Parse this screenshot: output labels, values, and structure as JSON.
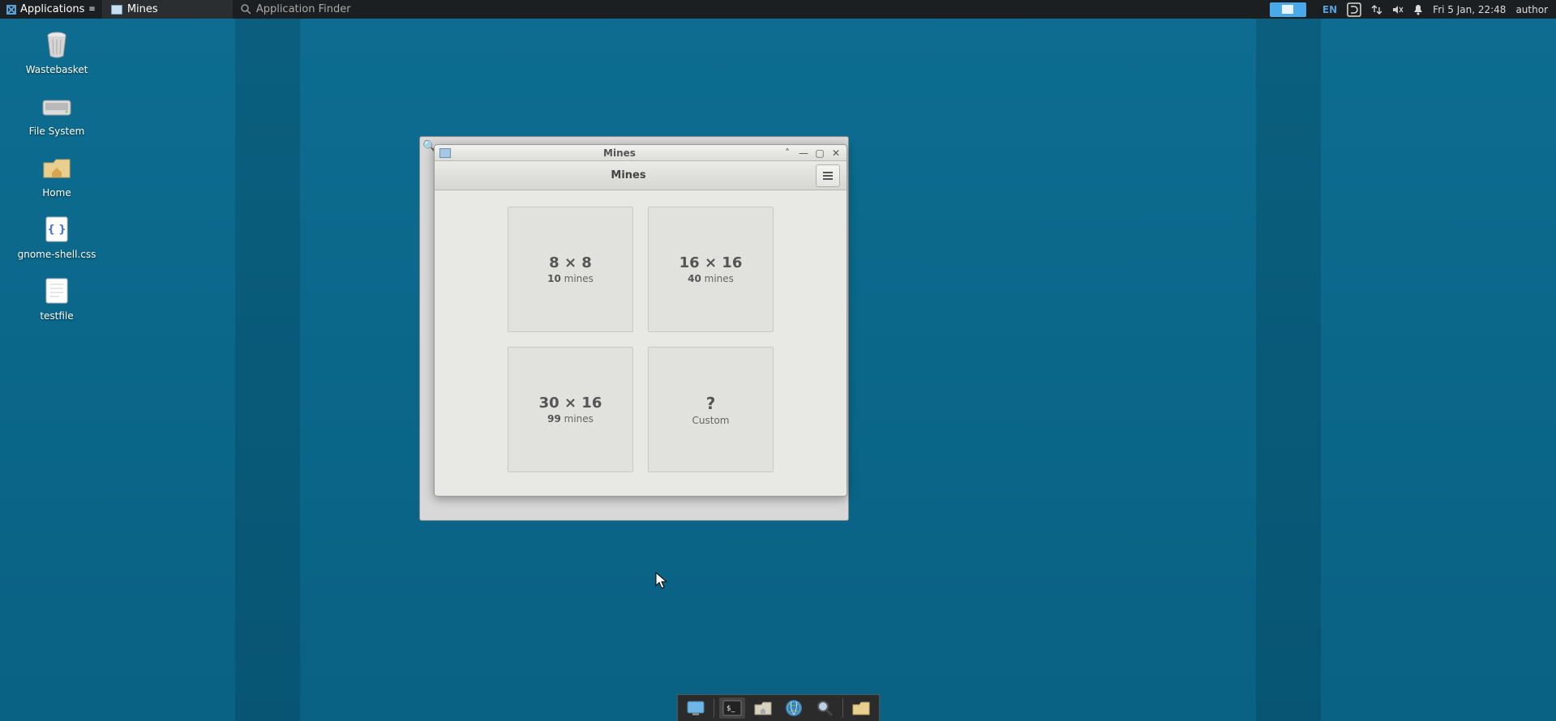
{
  "topbar": {
    "menu_label": "Applications",
    "task_label": "Mines",
    "search_placeholder": "Application Finder",
    "lang": "EN",
    "datetime": "Fri  5 Jan, 22:48",
    "user": "author"
  },
  "desktop_icons": [
    {
      "name": "wastebasket",
      "label": "Wastebasket"
    },
    {
      "name": "filesystem",
      "label": "File System"
    },
    {
      "name": "home",
      "label": "Home"
    },
    {
      "name": "css",
      "label": "gnome-shell.css"
    },
    {
      "name": "testfile",
      "label": "testfile"
    }
  ],
  "mines_window": {
    "outer_title": "Mines",
    "header_title": "Mines",
    "tiles": [
      {
        "size": "8 × 8",
        "mines": "10",
        "mines_word": "mines"
      },
      {
        "size": "16 × 16",
        "mines": "40",
        "mines_word": "mines"
      },
      {
        "size": "30 × 16",
        "mines": "99",
        "mines_word": "mines"
      },
      {
        "custom_symbol": "?",
        "custom_label": "Custom"
      }
    ]
  },
  "dock": {
    "items": [
      "show-desktop",
      "terminal",
      "file-manager",
      "web-browser",
      "search",
      "files"
    ]
  }
}
